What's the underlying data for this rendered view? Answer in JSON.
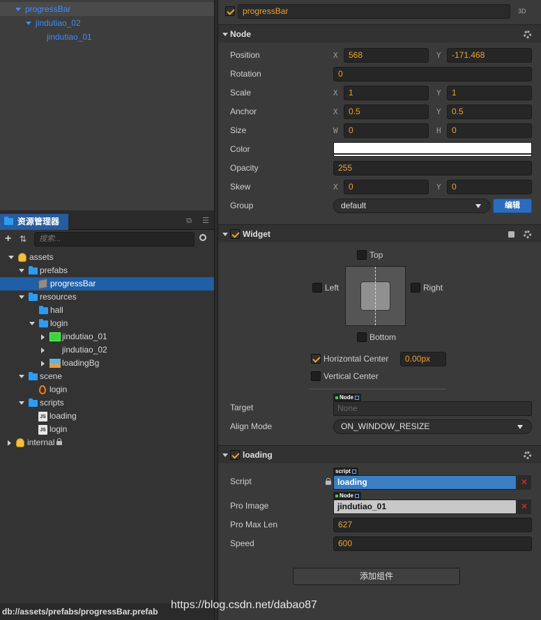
{
  "node_tree": {
    "items": [
      {
        "label": "progressBar"
      },
      {
        "label": "jindutiao_02"
      },
      {
        "label": "jindutiao_01"
      }
    ]
  },
  "assets_panel": {
    "tab_title": "资源管理器",
    "search_placeholder": "搜索...",
    "tree": [
      {
        "label": "assets",
        "icon": "database-icon"
      },
      {
        "label": "prefabs",
        "icon": "folder-icon"
      },
      {
        "label": "progressBar",
        "icon": "prefab-icon"
      },
      {
        "label": "resources",
        "icon": "folder-icon"
      },
      {
        "label": "hall",
        "icon": "folder-icon"
      },
      {
        "label": "login",
        "icon": "folder-icon"
      },
      {
        "label": "jindutiao_01",
        "icon": "sprite-icon"
      },
      {
        "label": "jindutiao_02",
        "icon": "sprite-icon"
      },
      {
        "label": "loadingBg",
        "icon": "image-icon"
      },
      {
        "label": "scene",
        "icon": "folder-icon"
      },
      {
        "label": "login",
        "icon": "scene-icon"
      },
      {
        "label": "scripts",
        "icon": "folder-icon"
      },
      {
        "label": "loading",
        "icon": "js-icon"
      },
      {
        "label": "login",
        "icon": "js-icon"
      },
      {
        "label": "internal",
        "icon": "database-icon"
      }
    ],
    "status_path": "db://assets/prefabs/progressBar.prefab"
  },
  "inspector": {
    "node_name": "progressBar",
    "label_3d": "3D",
    "node_section": {
      "title": "Node",
      "position": {
        "label": "Position",
        "x_axis": "X",
        "y_axis": "Y",
        "x": "568",
        "y": "-171.468"
      },
      "rotation": {
        "label": "Rotation",
        "value": "0"
      },
      "scale": {
        "label": "Scale",
        "x_axis": "X",
        "y_axis": "Y",
        "x": "1",
        "y": "1"
      },
      "anchor": {
        "label": "Anchor",
        "x_axis": "X",
        "y_axis": "Y",
        "x": "0.5",
        "y": "0.5"
      },
      "size": {
        "label": "Size",
        "w_axis": "W",
        "h_axis": "H",
        "w": "0",
        "h": "0"
      },
      "color": {
        "label": "Color",
        "value": "#ffffff"
      },
      "opacity": {
        "label": "Opacity",
        "value": "255"
      },
      "skew": {
        "label": "Skew",
        "x_axis": "X",
        "y_axis": "Y",
        "x": "0",
        "y": "0"
      },
      "group": {
        "label": "Group",
        "value": "default",
        "edit_label": "编辑"
      }
    },
    "widget_section": {
      "title": "Widget",
      "top": "Top",
      "left": "Left",
      "right": "Right",
      "bottom": "Bottom",
      "horizontal_center": "Horizontal Center",
      "horizontal_center_value": "0.00px",
      "vertical_center": "Vertical Center",
      "target": {
        "label": "Target",
        "tag": "Node",
        "value": "None"
      },
      "align_mode": {
        "label": "Align Mode",
        "value": "ON_WINDOW_RESIZE"
      }
    },
    "loading_section": {
      "title": "loading",
      "script": {
        "label": "Script",
        "tag": "script",
        "value": "loading"
      },
      "pro_image": {
        "label": "Pro Image",
        "tag": "Node",
        "value": "jindutiao_01"
      },
      "pro_max_len": {
        "label": "Pro Max Len",
        "value": "627"
      },
      "speed": {
        "label": "Speed",
        "value": "600"
      }
    },
    "add_component_label": "添加组件"
  },
  "watermark": "https://blog.csdn.net/dabao87",
  "colors": {
    "accent_orange": "#f0a030",
    "selection_blue": "#1e5fa8",
    "tree_blue": "#3d8cff",
    "remove_red": "#e03030"
  }
}
